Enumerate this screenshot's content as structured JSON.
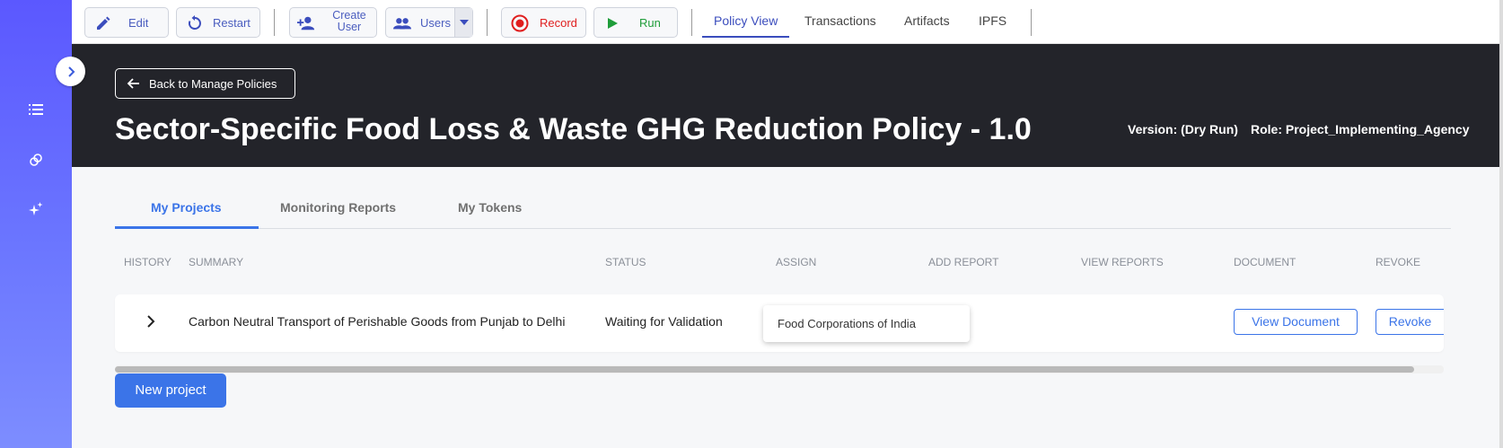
{
  "colors": {
    "sidebar_top": "#5b58ff",
    "sidebar_bottom": "#7d8dff",
    "header_bg": "#23242a",
    "accent": "#3b74e8",
    "record_red": "#e01e1e",
    "run_green": "#1f9d3a",
    "toolbar_blue": "#4a5dbf"
  },
  "sidebar": {
    "icons": [
      {
        "name": "list-icon"
      },
      {
        "name": "link-icon"
      },
      {
        "name": "sparkle-icon"
      }
    ],
    "collapse_icon": "chevron-right-icon"
  },
  "toolbar": {
    "edit_label": "Edit",
    "restart_label": "Restart",
    "create_user_label_1": "Create",
    "create_user_label_2": "User",
    "users_label": "Users",
    "record_label": "Record",
    "run_label": "Run",
    "tabs": [
      {
        "label": "Policy View"
      },
      {
        "label": "Transactions"
      },
      {
        "label": "Artifacts"
      },
      {
        "label": "IPFS"
      }
    ],
    "active_tab": "Policy View"
  },
  "header": {
    "back_label": "Back to Manage Policies",
    "title": "Sector-Specific Food Loss & Waste GHG Reduction Policy - 1.0",
    "version": "Version: (Dry Run)",
    "role": "Role: Project_Implementing_Agency"
  },
  "content_tabs": [
    {
      "label": "My Projects"
    },
    {
      "label": "Monitoring Reports"
    },
    {
      "label": "My Tokens"
    }
  ],
  "table": {
    "columns": [
      "HISTORY",
      "SUMMARY",
      "STATUS",
      "ASSIGN",
      "ADD REPORT",
      "VIEW REPORTS",
      "DOCUMENT",
      "REVOKE"
    ],
    "rows": [
      {
        "summary": "Carbon Neutral Transport of Perishable Goods from Punjab to Delhi",
        "status": "Waiting for Validation",
        "assign": "Food Corporations of India",
        "document_button": "View Document",
        "revoke_button": "Revoke"
      }
    ]
  },
  "new_project_label": "New project"
}
